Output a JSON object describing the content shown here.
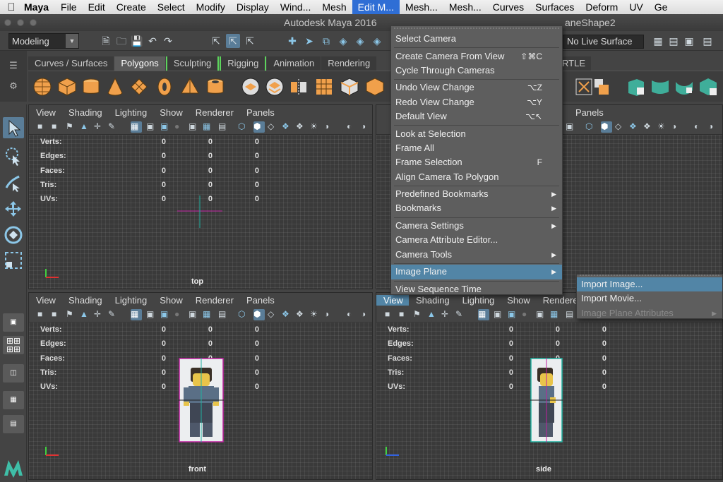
{
  "mac_menubar": {
    "app": "Maya",
    "items": [
      "File",
      "Edit",
      "Create",
      "Select",
      "Modify",
      "Display",
      "Wind...",
      "Mesh",
      "Edit M...",
      "Mesh...",
      "Mesh...",
      "Curves",
      "Surfaces",
      "Deform",
      "UV",
      "Ge"
    ]
  },
  "window": {
    "title": "Autodesk Maya 2016",
    "title_right": "aneShape2"
  },
  "status_line": {
    "mode": "Modeling",
    "live_surface": "No Live Surface"
  },
  "shelf": {
    "tabs": [
      "Curves / Surfaces",
      "Polygons",
      "Sculpting",
      "Rigging",
      "Animation",
      "Rendering"
    ],
    "active_tab": "Polygons",
    "tab_right": "RTLE",
    "accent_color": "#f0a04b"
  },
  "panels": {
    "menu": [
      "View",
      "Shading",
      "Lighting",
      "Show",
      "Renderer",
      "Panels"
    ],
    "side_menu": [
      "View",
      "Shading",
      "Lighting",
      "Show",
      "Renderer"
    ],
    "top_right_menu": [
      "Panels"
    ],
    "hud_labels": [
      "Verts:",
      "Edges:",
      "Faces:",
      "Tris:",
      "UVs:"
    ],
    "hud_values": [
      "0",
      "0",
      "0"
    ],
    "cams": {
      "top": "top",
      "front": "front",
      "side": "side"
    }
  },
  "view_menu": {
    "items": [
      {
        "label": "Select Camera",
        "shortcut": "",
        "sub": false
      },
      {
        "sep": true
      },
      {
        "label": "Create Camera From View",
        "shortcut": "⇧⌘C",
        "sub": false
      },
      {
        "label": "Cycle Through Cameras",
        "shortcut": "",
        "sub": false
      },
      {
        "sep": true
      },
      {
        "label": "Undo View Change",
        "shortcut": "⌥Z",
        "sub": false
      },
      {
        "label": "Redo View Change",
        "shortcut": "⌥Y",
        "sub": false
      },
      {
        "label": "Default View",
        "shortcut": "⌥↖",
        "sub": false
      },
      {
        "sep": true
      },
      {
        "label": "Look at Selection",
        "shortcut": "",
        "sub": false
      },
      {
        "label": "Frame All",
        "shortcut": "",
        "sub": false
      },
      {
        "label": "Frame Selection",
        "shortcut": "F",
        "sub": false
      },
      {
        "label": "Align Camera To Polygon",
        "shortcut": "",
        "sub": false
      },
      {
        "sep": true
      },
      {
        "label": "Predefined Bookmarks",
        "shortcut": "",
        "sub": true
      },
      {
        "label": "Bookmarks",
        "shortcut": "",
        "sub": true
      },
      {
        "sep": true
      },
      {
        "label": "Camera Settings",
        "shortcut": "",
        "sub": true
      },
      {
        "label": "Camera Attribute Editor...",
        "shortcut": "",
        "sub": false
      },
      {
        "label": "Camera Tools",
        "shortcut": "",
        "sub": true
      },
      {
        "sep": true
      },
      {
        "label": "Image Plane",
        "shortcut": "",
        "sub": true,
        "highlight": true
      },
      {
        "sep": true
      },
      {
        "label": "View Sequence Time",
        "shortcut": "",
        "sub": false
      }
    ]
  },
  "image_plane_submenu": {
    "items": [
      {
        "label": "Import Image...",
        "highlight": true,
        "disabled": false,
        "sub": false
      },
      {
        "label": "Import Movie...",
        "highlight": false,
        "disabled": false,
        "sub": false
      },
      {
        "label": "Image Plane Attributes",
        "highlight": false,
        "disabled": true,
        "sub": true
      }
    ]
  },
  "colors": {
    "selection_blue": "#5285a6",
    "maya_bg": "#444444",
    "viewport_bg": "#3a3a3a"
  }
}
